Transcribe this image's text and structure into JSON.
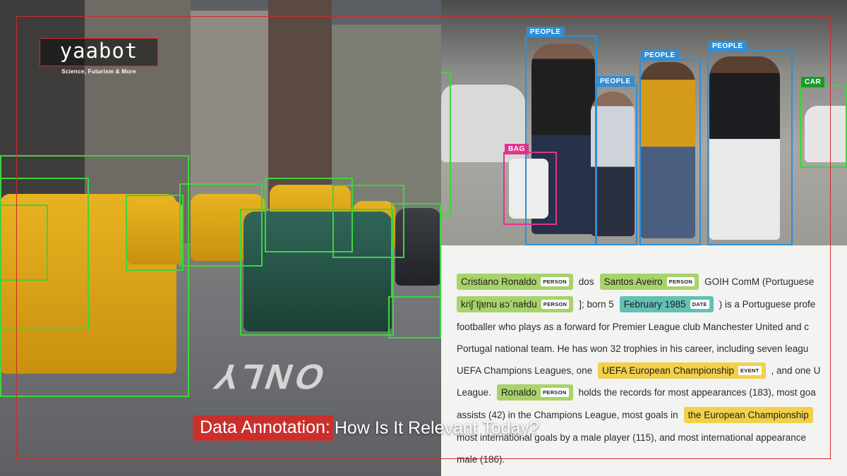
{
  "brand": {
    "logo": "yaabot",
    "tagline": "Science, Futurism & More"
  },
  "headline": {
    "highlight": "Data Annotation:",
    "rest": "How Is It Relevant Today?"
  },
  "street_scene": {
    "road_marking": "ONLY"
  },
  "people_scene": {
    "labels": [
      "PEOPLE",
      "PEOPLE",
      "PEOPLE",
      "PEOPLE",
      "BAG",
      "CAR"
    ]
  },
  "ner_document": {
    "line1": {
      "entity1": {
        "text": "Cristiano Ronaldo",
        "label": "PERSON"
      },
      "text1": "dos",
      "entity2": {
        "text": "Santos Aveiro",
        "label": "PERSON"
      },
      "text2": "GOIH ComM (Portuguese"
    },
    "line2": {
      "entity1": {
        "text": "kɾiʃˈtjɐnu ʁɔˈnaɫdu",
        "label": "PERSON"
      },
      "text1": "]; born 5",
      "entity2": {
        "text": "February 1985",
        "label": "DATE"
      },
      "text2": ") is a Portuguese profe"
    },
    "line3": "footballer who plays as a forward for Premier League club Manchester United and c",
    "line4": "Portugal national team. He has won 32 trophies in his career, including seven leagu",
    "line5": {
      "text1": "UEFA Champions Leagues, one",
      "entity1": {
        "text": "UEFA European Championship",
        "label": "EVENT"
      },
      "text2": ", and one U"
    },
    "line6": {
      "text1": "League.",
      "entity1": {
        "text": "Ronaldo",
        "label": "PERSON"
      },
      "text2": "holds the records for most appearances (183), most goa"
    },
    "line7": {
      "text1": "assists (42) in the Champions League, most goals in",
      "entity1": {
        "text": "the European Championship",
        "label": ""
      }
    },
    "line8": "most international goals by a male player (115), and most international appearance",
    "line9": "male (186)."
  },
  "colors": {
    "accent_red": "#c9302c",
    "box_green": "#3ed43e",
    "box_blue": "#2f8ed6",
    "box_pink": "#e0338f"
  }
}
